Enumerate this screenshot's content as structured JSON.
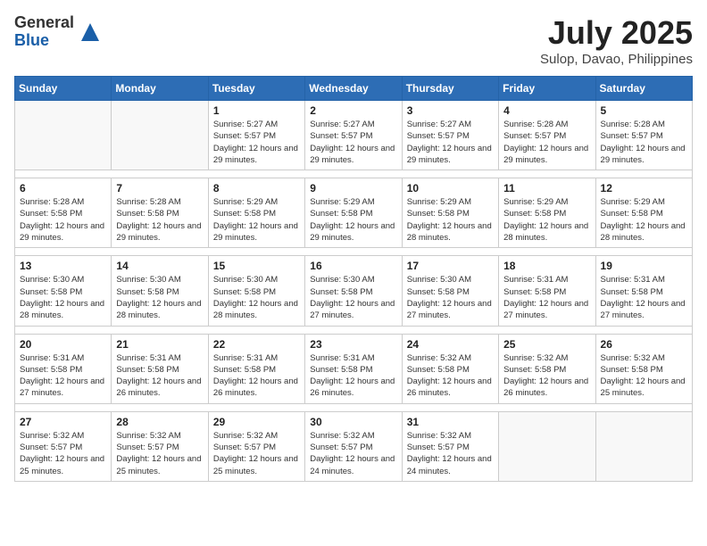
{
  "logo": {
    "general": "General",
    "blue": "Blue"
  },
  "title": "July 2025",
  "location": "Sulop, Davao, Philippines",
  "weekdays": [
    "Sunday",
    "Monday",
    "Tuesday",
    "Wednesday",
    "Thursday",
    "Friday",
    "Saturday"
  ],
  "weeks": [
    [
      {
        "day": "",
        "info": ""
      },
      {
        "day": "",
        "info": ""
      },
      {
        "day": "1",
        "info": "Sunrise: 5:27 AM\nSunset: 5:57 PM\nDaylight: 12 hours and 29 minutes."
      },
      {
        "day": "2",
        "info": "Sunrise: 5:27 AM\nSunset: 5:57 PM\nDaylight: 12 hours and 29 minutes."
      },
      {
        "day": "3",
        "info": "Sunrise: 5:27 AM\nSunset: 5:57 PM\nDaylight: 12 hours and 29 minutes."
      },
      {
        "day": "4",
        "info": "Sunrise: 5:28 AM\nSunset: 5:57 PM\nDaylight: 12 hours and 29 minutes."
      },
      {
        "day": "5",
        "info": "Sunrise: 5:28 AM\nSunset: 5:57 PM\nDaylight: 12 hours and 29 minutes."
      }
    ],
    [
      {
        "day": "6",
        "info": "Sunrise: 5:28 AM\nSunset: 5:58 PM\nDaylight: 12 hours and 29 minutes."
      },
      {
        "day": "7",
        "info": "Sunrise: 5:28 AM\nSunset: 5:58 PM\nDaylight: 12 hours and 29 minutes."
      },
      {
        "day": "8",
        "info": "Sunrise: 5:29 AM\nSunset: 5:58 PM\nDaylight: 12 hours and 29 minutes."
      },
      {
        "day": "9",
        "info": "Sunrise: 5:29 AM\nSunset: 5:58 PM\nDaylight: 12 hours and 29 minutes."
      },
      {
        "day": "10",
        "info": "Sunrise: 5:29 AM\nSunset: 5:58 PM\nDaylight: 12 hours and 28 minutes."
      },
      {
        "day": "11",
        "info": "Sunrise: 5:29 AM\nSunset: 5:58 PM\nDaylight: 12 hours and 28 minutes."
      },
      {
        "day": "12",
        "info": "Sunrise: 5:29 AM\nSunset: 5:58 PM\nDaylight: 12 hours and 28 minutes."
      }
    ],
    [
      {
        "day": "13",
        "info": "Sunrise: 5:30 AM\nSunset: 5:58 PM\nDaylight: 12 hours and 28 minutes."
      },
      {
        "day": "14",
        "info": "Sunrise: 5:30 AM\nSunset: 5:58 PM\nDaylight: 12 hours and 28 minutes."
      },
      {
        "day": "15",
        "info": "Sunrise: 5:30 AM\nSunset: 5:58 PM\nDaylight: 12 hours and 28 minutes."
      },
      {
        "day": "16",
        "info": "Sunrise: 5:30 AM\nSunset: 5:58 PM\nDaylight: 12 hours and 27 minutes."
      },
      {
        "day": "17",
        "info": "Sunrise: 5:30 AM\nSunset: 5:58 PM\nDaylight: 12 hours and 27 minutes."
      },
      {
        "day": "18",
        "info": "Sunrise: 5:31 AM\nSunset: 5:58 PM\nDaylight: 12 hours and 27 minutes."
      },
      {
        "day": "19",
        "info": "Sunrise: 5:31 AM\nSunset: 5:58 PM\nDaylight: 12 hours and 27 minutes."
      }
    ],
    [
      {
        "day": "20",
        "info": "Sunrise: 5:31 AM\nSunset: 5:58 PM\nDaylight: 12 hours and 27 minutes."
      },
      {
        "day": "21",
        "info": "Sunrise: 5:31 AM\nSunset: 5:58 PM\nDaylight: 12 hours and 26 minutes."
      },
      {
        "day": "22",
        "info": "Sunrise: 5:31 AM\nSunset: 5:58 PM\nDaylight: 12 hours and 26 minutes."
      },
      {
        "day": "23",
        "info": "Sunrise: 5:31 AM\nSunset: 5:58 PM\nDaylight: 12 hours and 26 minutes."
      },
      {
        "day": "24",
        "info": "Sunrise: 5:32 AM\nSunset: 5:58 PM\nDaylight: 12 hours and 26 minutes."
      },
      {
        "day": "25",
        "info": "Sunrise: 5:32 AM\nSunset: 5:58 PM\nDaylight: 12 hours and 26 minutes."
      },
      {
        "day": "26",
        "info": "Sunrise: 5:32 AM\nSunset: 5:58 PM\nDaylight: 12 hours and 25 minutes."
      }
    ],
    [
      {
        "day": "27",
        "info": "Sunrise: 5:32 AM\nSunset: 5:57 PM\nDaylight: 12 hours and 25 minutes."
      },
      {
        "day": "28",
        "info": "Sunrise: 5:32 AM\nSunset: 5:57 PM\nDaylight: 12 hours and 25 minutes."
      },
      {
        "day": "29",
        "info": "Sunrise: 5:32 AM\nSunset: 5:57 PM\nDaylight: 12 hours and 25 minutes."
      },
      {
        "day": "30",
        "info": "Sunrise: 5:32 AM\nSunset: 5:57 PM\nDaylight: 12 hours and 24 minutes."
      },
      {
        "day": "31",
        "info": "Sunrise: 5:32 AM\nSunset: 5:57 PM\nDaylight: 12 hours and 24 minutes."
      },
      {
        "day": "",
        "info": ""
      },
      {
        "day": "",
        "info": ""
      }
    ]
  ]
}
